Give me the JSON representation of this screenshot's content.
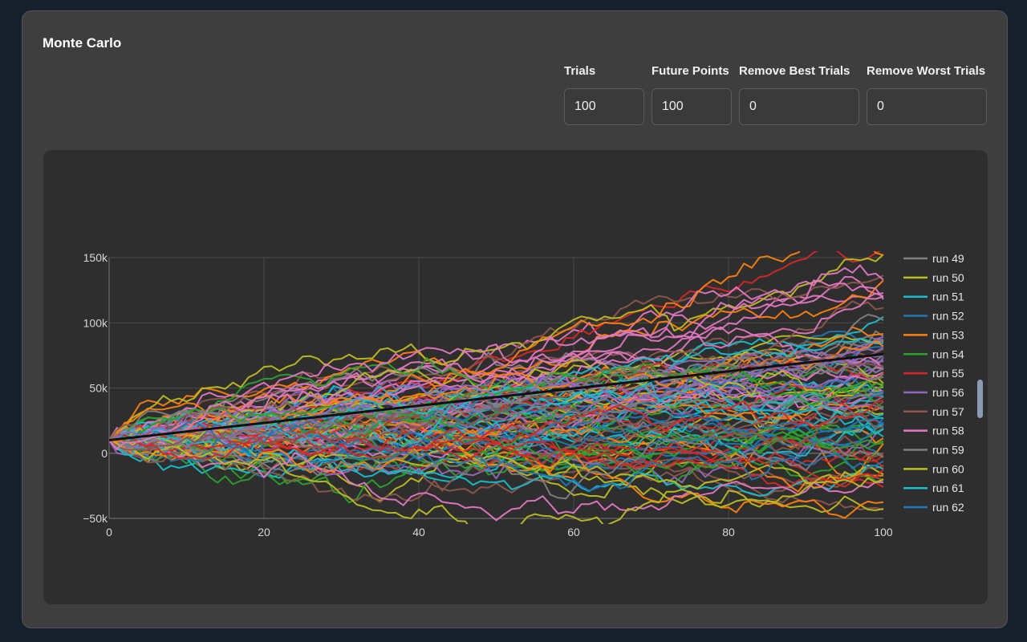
{
  "panel": {
    "title": "Monte Carlo"
  },
  "controls": [
    {
      "label": "Trials",
      "value": "100"
    },
    {
      "label": "Future Points",
      "value": "100"
    },
    {
      "label": "Remove Best Trials",
      "value": "0"
    },
    {
      "label": "Remove Worst Trials",
      "value": "0"
    }
  ],
  "chart_data": {
    "type": "line",
    "title": "",
    "xlabel": "",
    "ylabel": "",
    "xlim": [
      0,
      100
    ],
    "ylim": [
      -50000,
      150000
    ],
    "x_ticks": [
      "0",
      "20",
      "40",
      "60",
      "80",
      "100"
    ],
    "y_ticks": [
      "−50k",
      "0",
      "50k",
      "100k",
      "150k"
    ],
    "grid": true,
    "legend_position": "right",
    "legend_entries_visible": [
      "run 49",
      "run 50",
      "run 51",
      "run 52",
      "run 53",
      "run 54",
      "run 55",
      "run 56",
      "run 57",
      "run 58",
      "run 59",
      "run 60",
      "run 61",
      "run 62"
    ],
    "series_colors": [
      "#bcbd22",
      "#17becf",
      "#1f77b4",
      "#ff7f0e",
      "#2ca02c",
      "#d62728",
      "#9467bd",
      "#8c564b",
      "#e377c2",
      "#7f7f7f"
    ],
    "num_trials": 100,
    "start_value": 10000,
    "mean_line": {
      "start": 10000,
      "end": 76000,
      "color": "#111111"
    }
  }
}
